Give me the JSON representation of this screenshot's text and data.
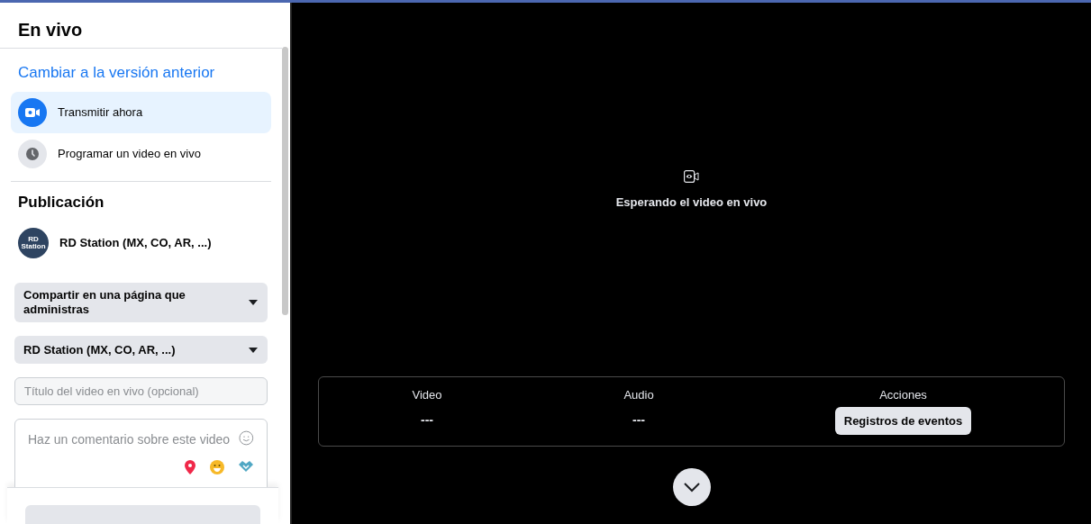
{
  "sidebar": {
    "title": "En vivo",
    "switch_link": "Cambiar a la versión anterior",
    "options": [
      {
        "label": "Transmitir ahora",
        "kind": "camera",
        "selected": true
      },
      {
        "label": "Programar un video en vivo",
        "kind": "clock",
        "selected": false
      }
    ],
    "section_title": "Publicación",
    "page_name": "RD Station (MX, CO, AR, ...)",
    "avatar_text": "RD Station",
    "share_dropdown": "Compartir en una página que administras",
    "page_dropdown": "RD Station (MX, CO, AR, ...)",
    "title_field": {
      "placeholder": "Título del video en vivo (opcional)"
    },
    "comment_field": {
      "placeholder": "Haz un comentario sobre este video"
    },
    "footer_button": {
      "disabled": true
    }
  },
  "preview": {
    "status": "Esperando el video en vivo",
    "stats": [
      {
        "label": "Video",
        "value": "---",
        "kind": "value"
      },
      {
        "label": "Audio",
        "value": "---",
        "kind": "value"
      },
      {
        "label": "Acciones",
        "value": "Registros de eventos",
        "kind": "button"
      }
    ]
  }
}
